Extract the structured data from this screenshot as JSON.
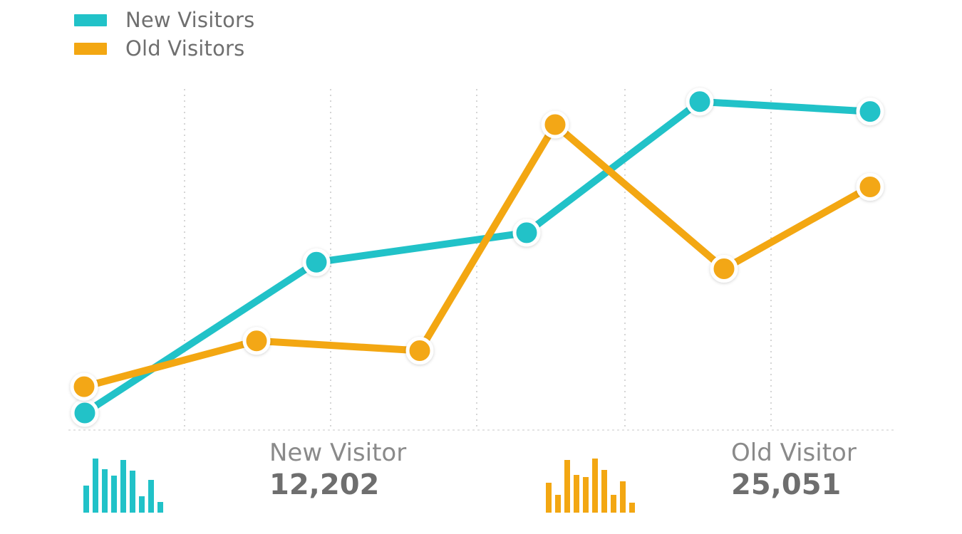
{
  "legend": {
    "series_0": "New Visitors",
    "series_1": "Old Visitors"
  },
  "colors": {
    "new": "#21c2c8",
    "old": "#f3a712",
    "grid": "#d5d5d5",
    "axis": "#e4e4e4"
  },
  "chart_data": {
    "type": "line",
    "x": [
      1,
      2,
      3,
      4,
      5,
      6
    ],
    "series": [
      {
        "name": "New Visitors",
        "values": [
          5,
          51,
          60,
          81,
          100,
          97
        ]
      },
      {
        "name": "Old Visitors",
        "values": [
          13,
          27,
          24,
          93,
          49,
          74
        ]
      }
    ],
    "ylim": [
      0,
      103
    ],
    "grid": "vertical-dotted",
    "legend_position": "top-left",
    "xlabel": "",
    "ylabel": ""
  },
  "stats": {
    "new": {
      "label": "New Visitor",
      "value": "12,202",
      "mini_bars": [
        0.5,
        1.0,
        0.8,
        0.68,
        0.98,
        0.78,
        0.3,
        0.6,
        0.2
      ]
    },
    "old": {
      "label": "Old Visitor",
      "value": "25,051",
      "mini_bars": [
        0.55,
        0.33,
        0.98,
        0.7,
        0.66,
        1.0,
        0.79,
        0.33,
        0.58,
        0.18
      ]
    }
  }
}
